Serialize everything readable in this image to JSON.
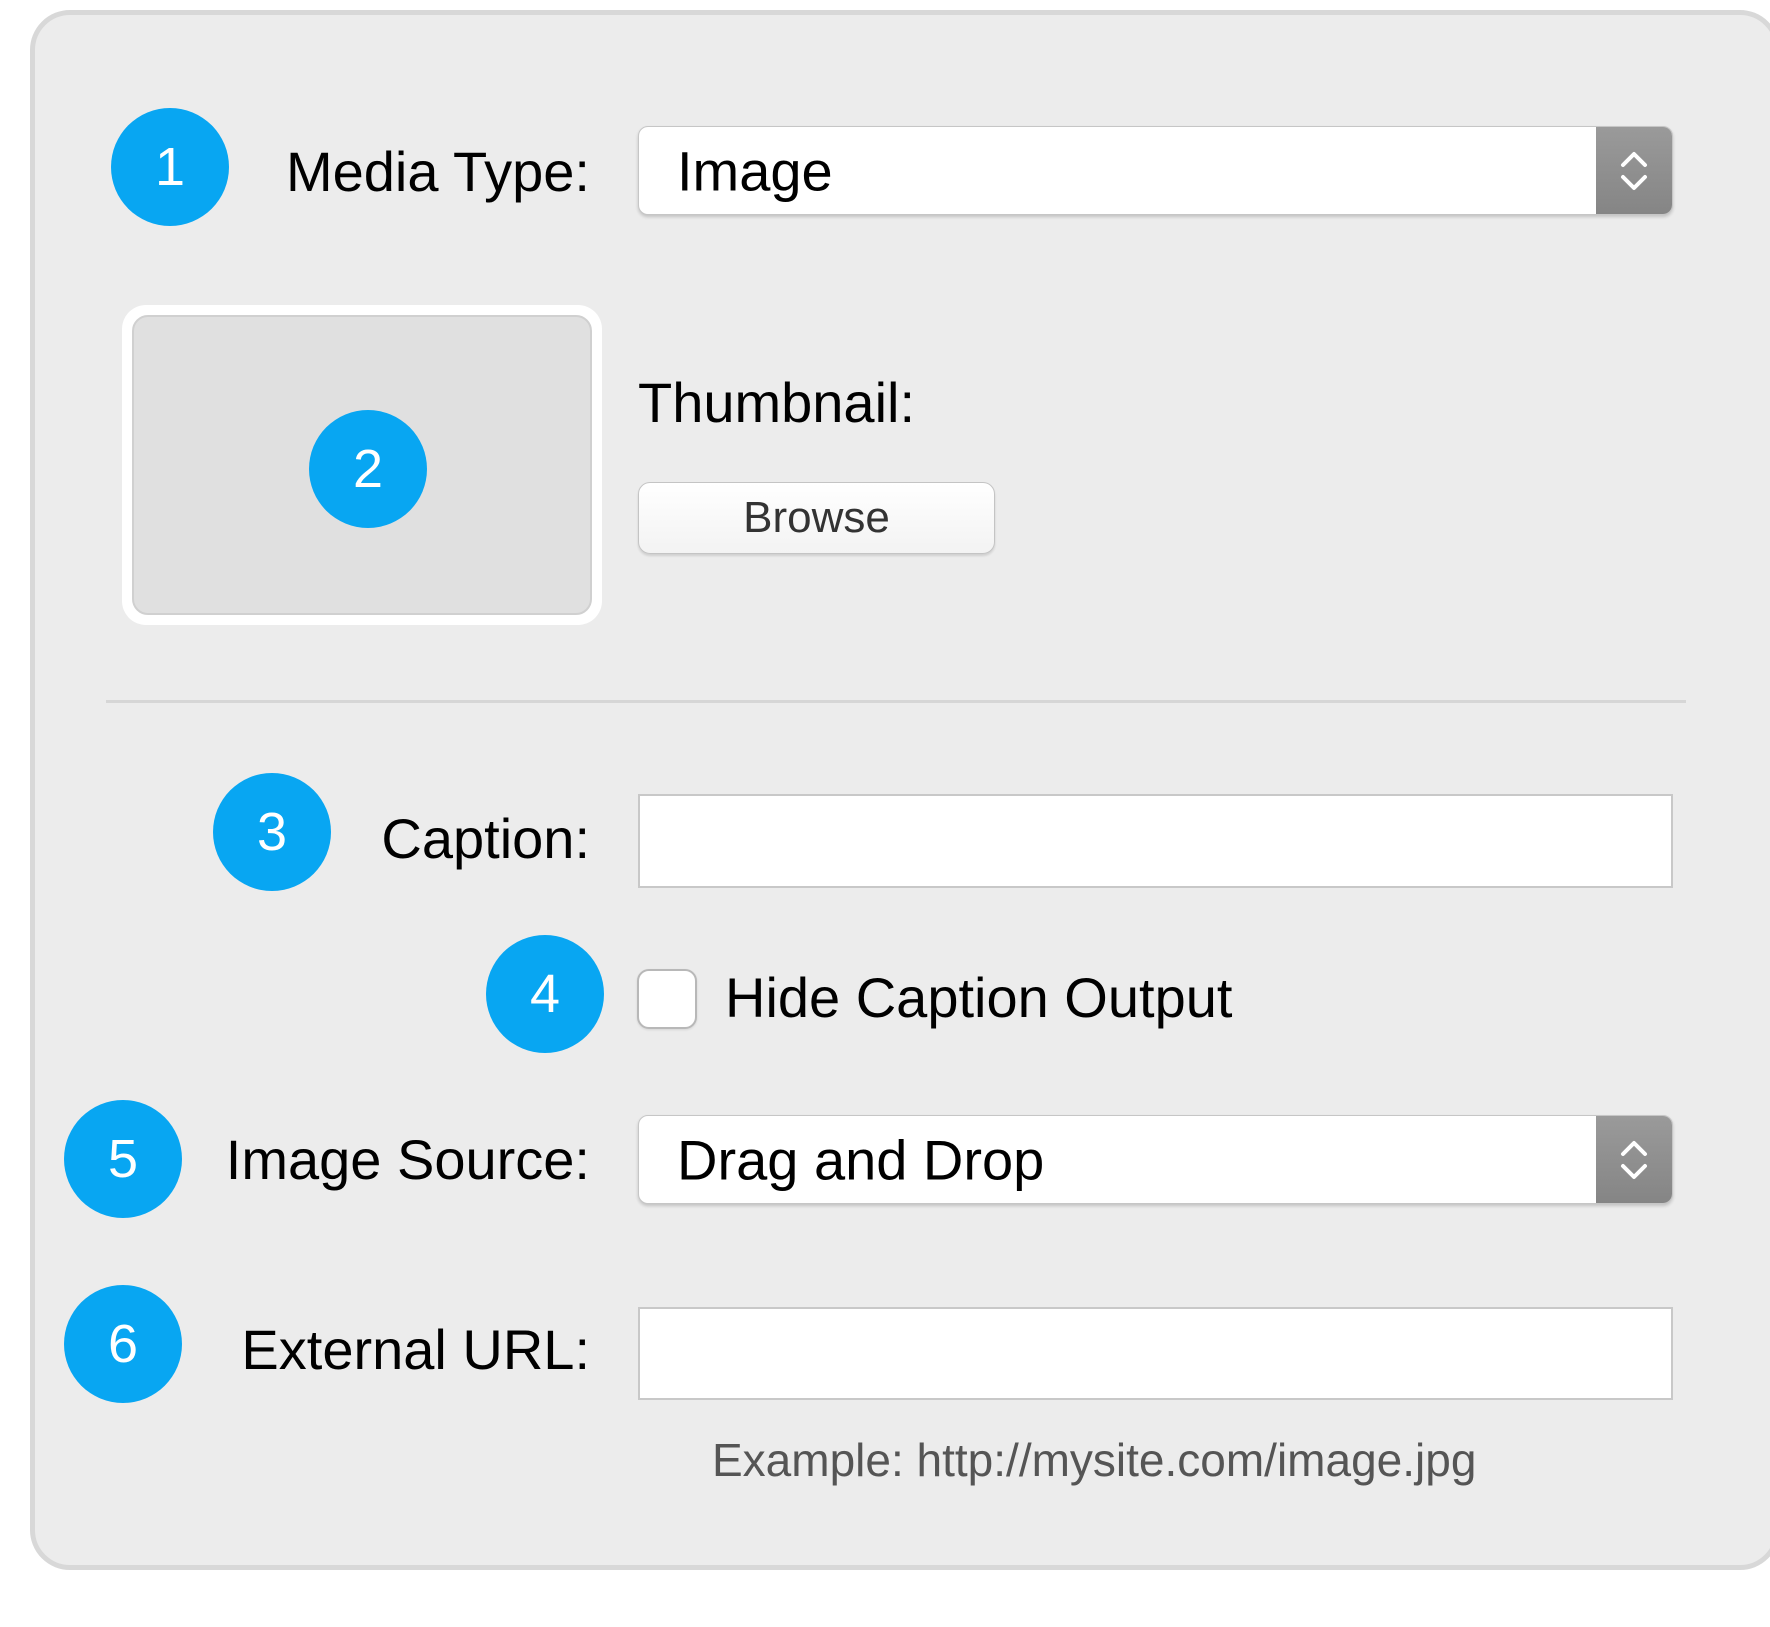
{
  "badges": [
    "1",
    "2",
    "3",
    "4",
    "5",
    "6"
  ],
  "media_type": {
    "label": "Media Type:",
    "value": "Image",
    "stepper_icon": "up-down-chevron-icon"
  },
  "thumbnail": {
    "label": "Thumbnail:",
    "browse_label": "Browse"
  },
  "caption": {
    "label": "Caption:",
    "value": ""
  },
  "hide_caption": {
    "label": "Hide Caption Output",
    "checked": false
  },
  "image_source": {
    "label": "Image Source:",
    "value": "Drag and Drop",
    "stepper_icon": "up-down-chevron-icon"
  },
  "external_url": {
    "label": "External URL:",
    "value": "",
    "hint": "Example: http://mysite.com/image.jpg"
  },
  "colors": {
    "badge": "#08a6f2",
    "panel_bg": "#ececec",
    "stepper": "#8f8f8f"
  }
}
